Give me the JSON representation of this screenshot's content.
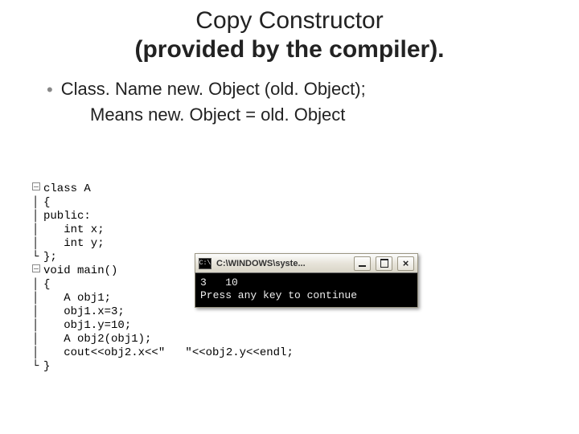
{
  "title": {
    "line1": "Copy Constructor",
    "line2": "(provided by the compiler)."
  },
  "bullets": [
    {
      "text": "Class. Name  new. Object  (old. Object);",
      "sub": "Means  new. Object = old. Object"
    }
  ],
  "code": [
    "class A",
    "{",
    "public:",
    "   int x;",
    "   int y;",
    "};",
    "void main()",
    "{",
    "   A obj1;",
    "   obj1.x=3;",
    "   obj1.y=10;",
    "   A obj2(obj1);",
    "   cout<<obj2.x<<\"   \"<<obj2.y<<endl;",
    "}"
  ],
  "console": {
    "icon_label": "C:\\",
    "title": "C:\\WINDOWS\\syste...",
    "output": "3   10\nPress any key to continue"
  }
}
